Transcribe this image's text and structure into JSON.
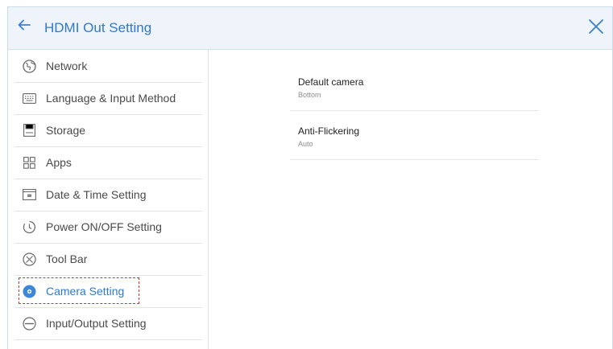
{
  "header": {
    "title": "HDMI Out Setting",
    "back_icon": "arrow-left-icon",
    "close_icon": "close-icon"
  },
  "sidebar": {
    "items": [
      {
        "label": "Network",
        "icon": "globe-icon"
      },
      {
        "label": "Language & Input Method",
        "icon": "keyboard-icon"
      },
      {
        "label": "Storage",
        "icon": "storage-icon"
      },
      {
        "label": "Apps",
        "icon": "apps-grid-icon"
      },
      {
        "label": "Date & Time Setting",
        "icon": "calendar-icon"
      },
      {
        "label": "Power ON/OFF Setting",
        "icon": "power-timer-icon"
      },
      {
        "label": "Tool Bar",
        "icon": "toolbar-icon"
      },
      {
        "label": "Camera Setting",
        "icon": "camera-icon",
        "active": true
      },
      {
        "label": "Input/Output Setting",
        "icon": "input-output-icon"
      }
    ]
  },
  "settings": [
    {
      "name": "Default camera",
      "value": "Bottom"
    },
    {
      "name": "Anti-Flickering",
      "value": "Auto"
    }
  ],
  "colors": {
    "accent": "#2f79cc",
    "header_bg": "#eef4fa",
    "highlight_border": "#d6322f"
  }
}
